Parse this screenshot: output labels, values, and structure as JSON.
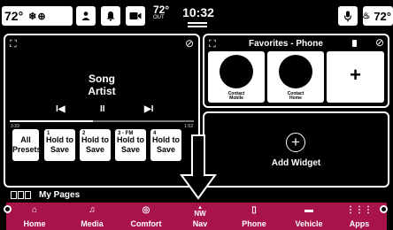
{
  "status_bar": {
    "left_temp": "72°",
    "outside_temp": "72°",
    "outside_label": "OUT",
    "clock": "10:32",
    "right_temp": "72°"
  },
  "media": {
    "song": "Song",
    "artist": "Artist",
    "time_current": "3:33",
    "time_total": "1:52",
    "progress": 0.45,
    "presets": [
      {
        "label": "All Presets"
      },
      {
        "num": "1",
        "label": "Hold to Save"
      },
      {
        "num": "2",
        "label": "Hold to Save"
      },
      {
        "num": "3 - FM",
        "label": "Hold to Save"
      },
      {
        "num": "4",
        "label": "Hold to Save"
      }
    ]
  },
  "favorites": {
    "title": "Favorites - Phone",
    "contacts": [
      {
        "line1": "Contact",
        "line2": "Mobile"
      },
      {
        "line1": "Contact",
        "line2": "Home"
      }
    ],
    "add_symbol": "+"
  },
  "widget": {
    "add_symbol": "+",
    "label": "Add Widget"
  },
  "pages": {
    "label": "My Pages"
  },
  "nav": {
    "home": "Home",
    "media": "Media",
    "comfort": "Comfort",
    "nav_label": "Nav",
    "compass": "NW",
    "phone": "Phone",
    "vehicle": "Vehicle",
    "apps": "Apps"
  },
  "colors": {
    "nav_bar": "#a8144a",
    "background": "#000000",
    "tiles": "#ffffff"
  },
  "icons": [
    "climate-fan-icon",
    "seat-heat-icon",
    "driver-icon",
    "notification-bell-icon",
    "camera-icon",
    "microphone-icon",
    "heated-seat-icon",
    "expand-icon",
    "edit-icon",
    "previous-track-icon",
    "pause-icon",
    "next-track-icon",
    "phone-icon",
    "home-icon",
    "music-note-icon",
    "comfort-icon",
    "compass-icon",
    "vehicle-icon",
    "apps-grid-icon"
  ]
}
